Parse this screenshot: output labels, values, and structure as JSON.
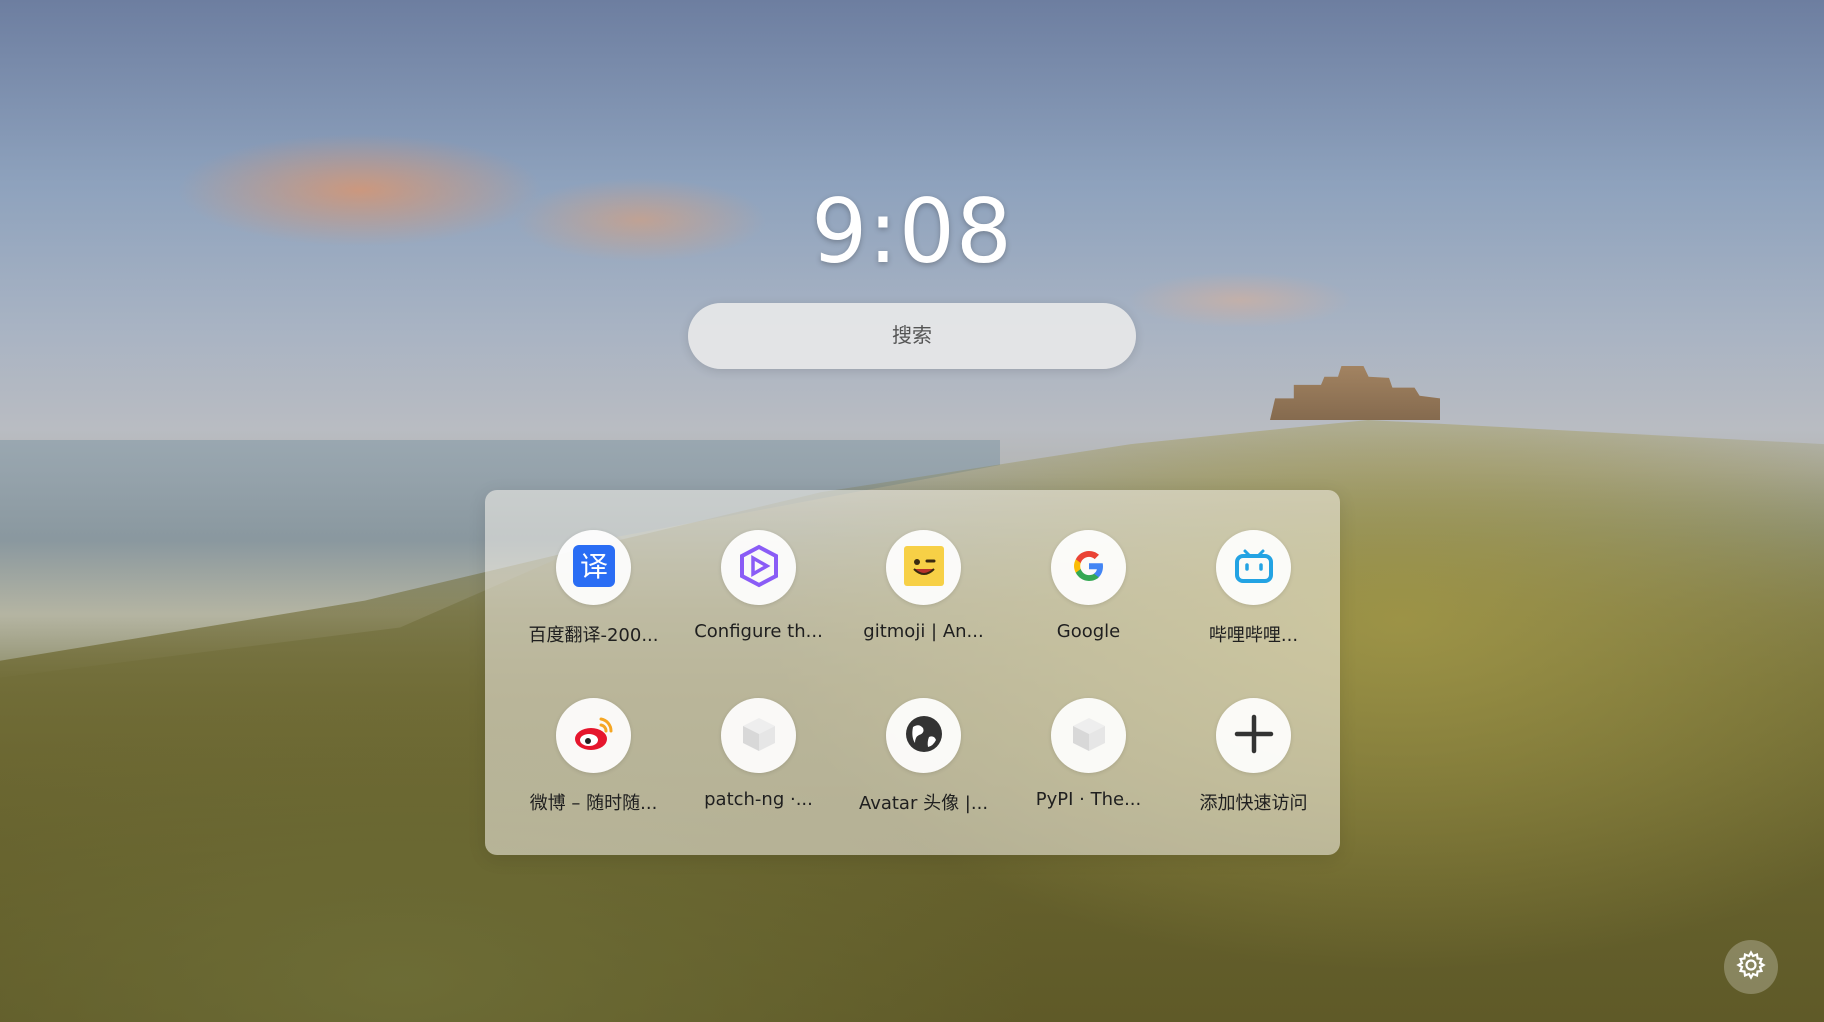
{
  "clock": {
    "time": "9:08"
  },
  "search": {
    "placeholder": "搜索"
  },
  "shortcuts": [
    {
      "label": "百度翻译-200...",
      "icon": "baidu-translate-icon",
      "color": "#2a6df4"
    },
    {
      "label": "Configure th...",
      "icon": "visual-studio-icon",
      "color": "#8a5cf6"
    },
    {
      "label": "gitmoji | An...",
      "icon": "gitmoji-icon",
      "color": "#f7d046"
    },
    {
      "label": "Google",
      "icon": "google-icon",
      "color": "#4285f4"
    },
    {
      "label": "哔哩哔哩...",
      "icon": "bilibili-icon",
      "color": "#23a3e3"
    },
    {
      "label": "微博 – 随时随...",
      "icon": "weibo-icon",
      "color": "#e6162d"
    },
    {
      "label": "patch-ng ·...",
      "icon": "placeholder-cube-icon",
      "color": "#d9d9d9"
    },
    {
      "label": "Avatar 头像 |...",
      "icon": "globe-icon",
      "color": "#333333"
    },
    {
      "label": "PyPI · The...",
      "icon": "placeholder-cube-icon",
      "color": "#d9d9d9"
    },
    {
      "label": "添加快速访问",
      "icon": "plus-icon",
      "color": "#333333"
    }
  ],
  "settings": {
    "icon": "gear-icon"
  }
}
